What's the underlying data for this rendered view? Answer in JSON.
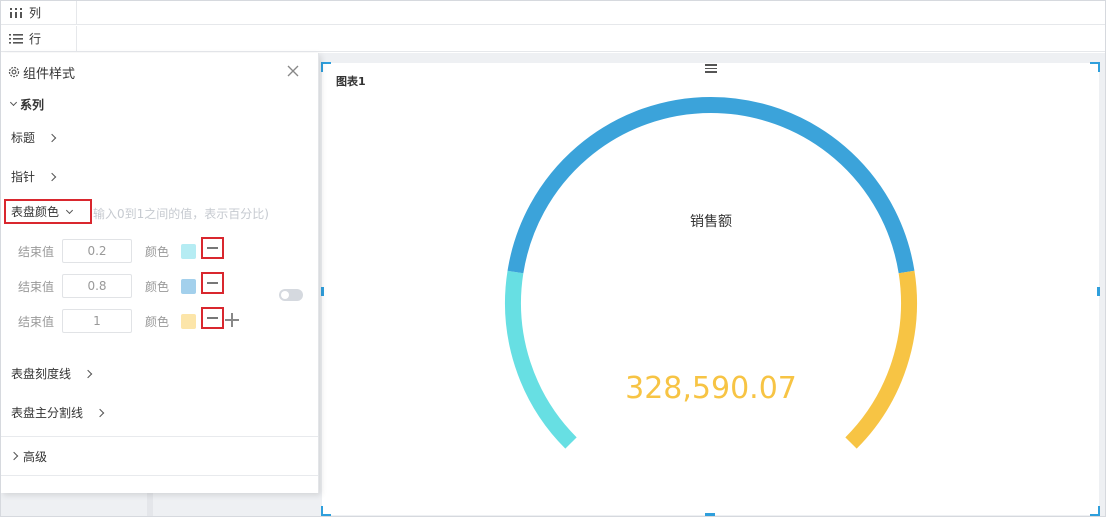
{
  "shelves": {
    "columns_label": "列",
    "rows_label": "行"
  },
  "panel": {
    "title": "组件样式",
    "section_series": "系列",
    "items": {
      "title": "标题",
      "pointer": "指针",
      "dial_color": "表盘颜色",
      "dial_ticks": "表盘刻度线",
      "dial_split": "表盘主分割线"
    },
    "hint": "输入0到1之间的值，表示百分比)",
    "end_value_label": "结束值",
    "color_label": "颜色",
    "ranges": [
      {
        "end": "0.2",
        "color": "#b5ecf3"
      },
      {
        "end": "0.8",
        "color": "#a3d0ec"
      },
      {
        "end": "1",
        "color": "#fce5a9"
      }
    ],
    "section_advanced": "高级"
  },
  "chart": {
    "title": "图表1"
  },
  "chart_data": {
    "type": "gauge",
    "title": "",
    "series_name": "销售额",
    "value_text": "328,590.07",
    "bands": [
      {
        "end": 0.2,
        "color": "#67dfe3"
      },
      {
        "end": 0.8,
        "color": "#3ba3da"
      },
      {
        "end": 1.0,
        "color": "#f7c444"
      }
    ],
    "value_color": "#f7c444"
  }
}
